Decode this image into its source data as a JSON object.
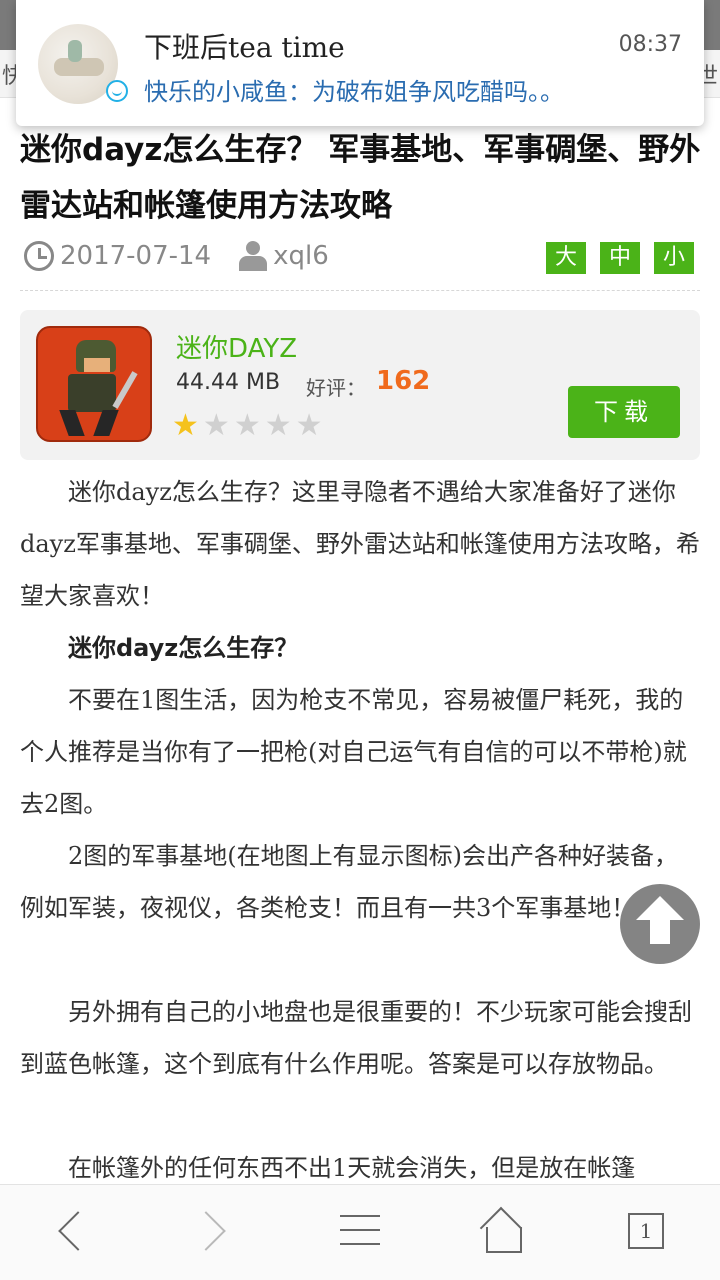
{
  "notification": {
    "title": "下班后tea time",
    "time": "08:37",
    "message": "快乐的小咸鱼：为破布姐争风吃醋吗。。"
  },
  "underbar": {
    "left_char": "快",
    "right_char": "世"
  },
  "article": {
    "title": "迷你dayz怎么生存？ 军事基地、军事碉堡、野外雷达站和帐篷使用方法攻略",
    "date": "2017-07-14",
    "author": "xql6",
    "font_sizes": [
      "大",
      "中",
      "小"
    ]
  },
  "app_card": {
    "name": "迷你DAYZ",
    "size": "44.44 MB",
    "rating_label": "好评：",
    "rating_value": "162",
    "stars_filled": 1,
    "stars_total": 5,
    "download_label": "下载"
  },
  "paragraphs": [
    {
      "text": "迷你dayz怎么生存？这里寻隐者不遇给大家准备好了迷你dayz军事基地、军事碉堡、野外雷达站和帐篷使用方法攻略，希望大家喜欢！",
      "bold": false
    },
    {
      "text": "迷你dayz怎么生存？",
      "bold": true
    },
    {
      "text": "不要在1图生活，因为枪支不常见，容易被僵尸耗死，我的个人推荐是当你有了一把枪(对自己运气有自信的可以不带枪)就去2图。",
      "bold": false
    },
    {
      "text": "2图的军事基地(在地图上有显示图标)会出产各种好装备，例如军装，夜视仪，各类枪支！而且有一共3个军事基地！",
      "bold": false
    },
    {
      "text": "另外拥有自己的小地盘也是很重要的！不少玩家可能会搜刮到蓝色帐篷，这个到底有什么作用呢。答案是可以存放物品。",
      "bold": false
    },
    {
      "text": "在帐篷外的任何东西不出1天就会消失，但是放在帐篷",
      "bold": false
    }
  ],
  "bottom_bar": {
    "tab_count": "1"
  },
  "colors": {
    "accent": "#4bb318",
    "rating": "#f06a1c",
    "link": "#2a6cb0"
  }
}
